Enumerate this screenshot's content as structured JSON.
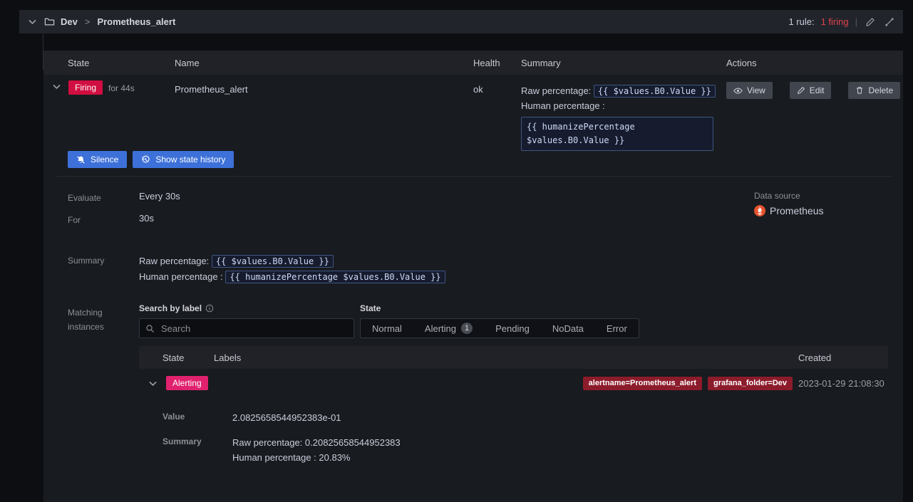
{
  "colors": {
    "accent_blue": "#3d71d9",
    "firing_red": "#d10e41",
    "alerting_pink": "#e0226e",
    "label_badge_red": "#8c1c2b",
    "datasource_orange": "#e6522c",
    "code_border_blue": "#3f5584"
  },
  "header": {
    "breadcrumb": {
      "folder": "Dev",
      "separator": ">",
      "rule": "Prometheus_alert"
    },
    "rules_count_prefix": "1 rule:",
    "rules_count_firing": "1 firing",
    "divider": "|"
  },
  "rules_table": {
    "columns": [
      "State",
      "Name",
      "Health",
      "Summary",
      "Actions"
    ],
    "row": {
      "state_badge": "Firing",
      "for_duration": "for 44s",
      "name": "Prometheus_alert",
      "health": "ok",
      "summary": {
        "raw_label": "Raw percentage:",
        "raw_code": "{{ $values.B0.Value }}",
        "human_label": "Human percentage :",
        "human_code": "{{ humanizePercentage $values.B0.Value }}"
      },
      "actions": {
        "view": "View",
        "edit": "Edit",
        "delete": "Delete"
      }
    }
  },
  "buttons": {
    "silence": "Silence",
    "show_history": "Show state history"
  },
  "details": {
    "evaluate": {
      "label": "Evaluate",
      "value": "Every 30s"
    },
    "for": {
      "label": "For",
      "value": "30s"
    },
    "datasource": {
      "label": "Data source",
      "value": "Prometheus"
    },
    "summary": {
      "label": "Summary",
      "raw_label": "Raw percentage:",
      "raw_code": "{{ $values.B0.Value }}",
      "human_label": "Human percentage :",
      "human_code": "{{ humanizePercentage $values.B0.Value }}"
    },
    "matching": {
      "label_line1": "Matching",
      "label_line2": "instances"
    }
  },
  "matching": {
    "search": {
      "label": "Search by label",
      "placeholder": "Search"
    },
    "state_filter": {
      "label": "State",
      "options": [
        {
          "label": "Normal"
        },
        {
          "label": "Alerting",
          "badge": "1"
        },
        {
          "label": "Pending"
        },
        {
          "label": "NoData"
        },
        {
          "label": "Error"
        }
      ]
    }
  },
  "instances_table": {
    "columns": [
      "State",
      "Labels",
      "Created"
    ],
    "row": {
      "state_badge": "Alerting",
      "labels": [
        "alertname=Prometheus_alert",
        "grafana_folder=Dev"
      ],
      "created": "2023-01-29 21:08:30",
      "details": {
        "value_label": "Value",
        "value": "2.0825658544952383e-01",
        "summary_label": "Summary",
        "summary_lines": [
          "Raw percentage: 0.20825658544952383",
          "Human percentage : 20.83%"
        ]
      }
    }
  }
}
